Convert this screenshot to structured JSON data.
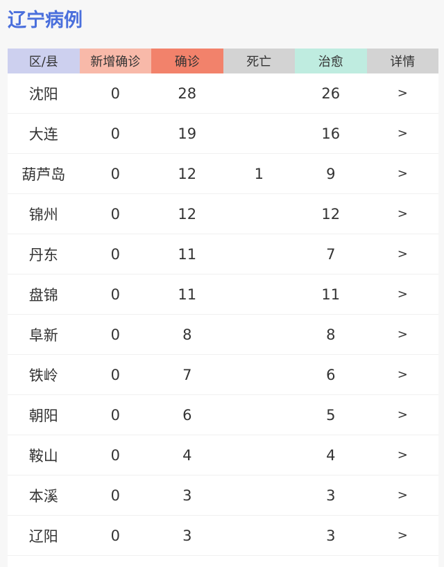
{
  "page": {
    "title": "辽宁病例"
  },
  "colors": {
    "title": "#4a6fdc",
    "header_district": "#cdd0ef",
    "header_new": "#f8b9a9",
    "header_confirmed": "#f2826b",
    "header_death": "#d3d3d3",
    "header_cured": "#bfece0",
    "header_detail": "#d3d3d3"
  },
  "table": {
    "headers": {
      "district": "区/县",
      "new_confirmed": "新增确诊",
      "confirmed": "确诊",
      "death": "死亡",
      "cured": "治愈",
      "detail": "详情"
    },
    "rows": [
      {
        "name": "沈阳",
        "new": "0",
        "confirmed": "28",
        "death": "",
        "cured": "26",
        "detail": ">"
      },
      {
        "name": "大连",
        "new": "0",
        "confirmed": "19",
        "death": "",
        "cured": "16",
        "detail": ">"
      },
      {
        "name": "葫芦岛",
        "new": "0",
        "confirmed": "12",
        "death": "1",
        "cured": "9",
        "detail": ">"
      },
      {
        "name": "锦州",
        "new": "0",
        "confirmed": "12",
        "death": "",
        "cured": "12",
        "detail": ">"
      },
      {
        "name": "丹东",
        "new": "0",
        "confirmed": "11",
        "death": "",
        "cured": "7",
        "detail": ">"
      },
      {
        "name": "盘锦",
        "new": "0",
        "confirmed": "11",
        "death": "",
        "cured": "11",
        "detail": ">"
      },
      {
        "name": "阜新",
        "new": "0",
        "confirmed": "8",
        "death": "",
        "cured": "8",
        "detail": ">"
      },
      {
        "name": "铁岭",
        "new": "0",
        "confirmed": "7",
        "death": "",
        "cured": "6",
        "detail": ">"
      },
      {
        "name": "朝阳",
        "new": "0",
        "confirmed": "6",
        "death": "",
        "cured": "5",
        "detail": ">"
      },
      {
        "name": "鞍山",
        "new": "0",
        "confirmed": "4",
        "death": "",
        "cured": "4",
        "detail": ">"
      },
      {
        "name": "本溪",
        "new": "0",
        "confirmed": "3",
        "death": "",
        "cured": "3",
        "detail": ">"
      },
      {
        "name": "辽阳",
        "new": "0",
        "confirmed": "3",
        "death": "",
        "cured": "3",
        "detail": ">"
      }
    ]
  }
}
